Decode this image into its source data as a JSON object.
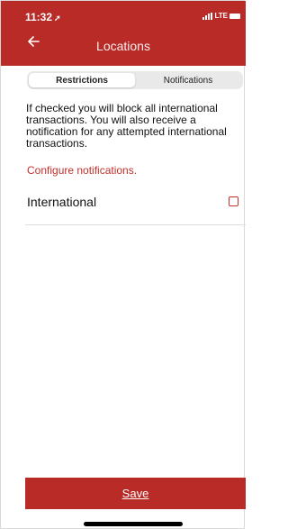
{
  "status_bar": {
    "time": "11:32",
    "location_arrow": "➚",
    "network": "LTE"
  },
  "nav": {
    "title": "Locations",
    "back_icon": "arrow-left-icon"
  },
  "tabs": [
    {
      "label": "Restrictions",
      "active": true
    },
    {
      "label": "Notifications",
      "active": false
    }
  ],
  "description": "If checked you will block all international transactions.  You will also receive a notification for any attempted international transactions.",
  "configure_link": "Configure notifications.",
  "option": {
    "label": "International",
    "checked": false
  },
  "save_label": "Save",
  "colors": {
    "brand": "#b92b27",
    "accent": "#c0302b"
  }
}
